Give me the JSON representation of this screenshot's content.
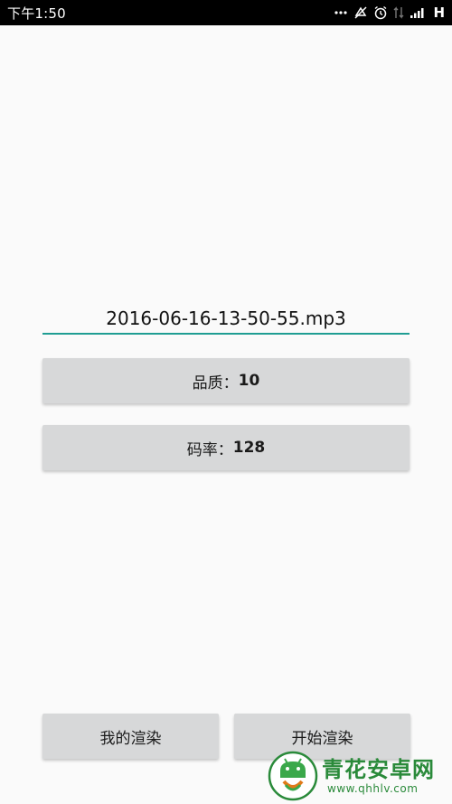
{
  "status_bar": {
    "time": "下午1:50",
    "network_type": "H",
    "icons": [
      "mute-icon",
      "sync-off-icon",
      "alarm-icon",
      "data-transfer-icon",
      "signal-icon"
    ]
  },
  "filename_field": {
    "value": "2016-06-16-13-50-55.mp3"
  },
  "quality_button": {
    "label": "品质：",
    "value": "10"
  },
  "bitrate_button": {
    "label": "码率：",
    "value": "128"
  },
  "bottom_buttons": {
    "my_renders_label": "我的渲染",
    "start_render_label": "开始渲染"
  },
  "watermark": {
    "title": "青花安卓网",
    "url": "www.qhhlv.com"
  },
  "colors": {
    "accent": "#1f9d93",
    "button_bg": "#d7d8d9",
    "background": "#fafafa",
    "watermark_green": "#2a8a3a"
  }
}
